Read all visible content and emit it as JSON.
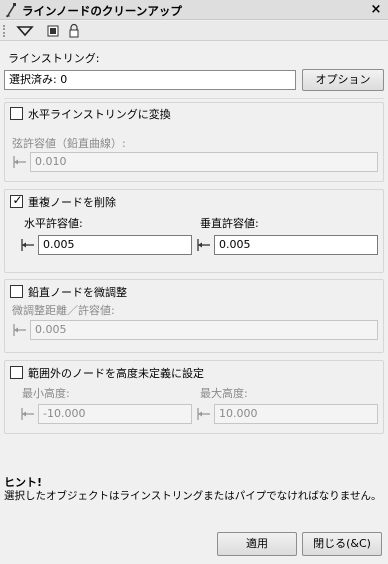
{
  "window": {
    "title": "ラインノードのクリーンアップ",
    "close_label": "×"
  },
  "toolbar": {
    "icons": [
      "dropdown-triangle-icon",
      "image-icon",
      "lock-icon"
    ]
  },
  "linestring": {
    "label": "ラインストリング:",
    "selection_value": "選択済み: 0",
    "options_button": "オプション"
  },
  "convert_horizontal": {
    "checkbox_label": "水平ラインストリングに変換",
    "checked": false,
    "chord_tolerance_label": "弦許容値（鉛直曲線）:",
    "chord_tolerance_value": "0.010"
  },
  "remove_duplicates": {
    "checkbox_label": "重複ノードを削除",
    "checked": true,
    "horizontal_tolerance_label": "水平許容値:",
    "horizontal_tolerance_value": "0.005",
    "vertical_tolerance_label": "垂直許容値:",
    "vertical_tolerance_value": "0.005"
  },
  "fine_adjust_vertical": {
    "checkbox_label": "鉛直ノードを微調整",
    "checked": false,
    "distance_label": "微調整距離／許容値:",
    "distance_value": "0.005"
  },
  "out_of_range": {
    "checkbox_label": "範囲外のノードを高度未定義に設定",
    "checked": false,
    "min_elevation_label": "最小高度:",
    "min_elevation_value": "-10.000",
    "max_elevation_label": "最大高度:",
    "max_elevation_value": "10.000"
  },
  "hint": {
    "title": "ヒント!",
    "text": "選択したオブジェクトはラインストリングまたはパイプでなければなりません。"
  },
  "footer": {
    "apply_button": "適用",
    "close_button": "閉じる(&C)"
  }
}
